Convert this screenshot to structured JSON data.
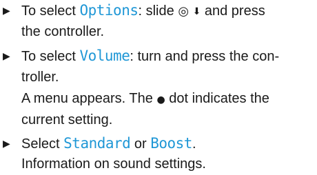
{
  "bullet_glyph": "▶",
  "steps": [
    {
      "lines": [
        {
          "a": "To select ",
          "term": "Options",
          "b": ": slide ",
          "icon1": "◎",
          "icon2": "⬇",
          "c": " and press"
        },
        {
          "a": "the controller."
        }
      ]
    },
    {
      "lines": [
        {
          "a": "To select ",
          "term": "Volume",
          "b": ": turn and press the con-"
        },
        {
          "a": "troller."
        }
      ]
    },
    {
      "lines": [
        {
          "a": "Select ",
          "term1": "Standard",
          "mid": " or ",
          "term2": "Boost",
          "end": "."
        }
      ]
    }
  ],
  "result": {
    "line1_a": "A menu appears. The ",
    "dot_glyph": "●",
    "line1_b": " dot indicates the",
    "line2": "current setting."
  },
  "info_text": "Information on sound settings.",
  "icons": {
    "controller": "controller-circle-icon",
    "slide_down": "arrow-down-icon",
    "dot": "filled-dot-icon"
  },
  "colors": {
    "menu_term": "#1f97d6",
    "text": "#1a1a1a"
  }
}
